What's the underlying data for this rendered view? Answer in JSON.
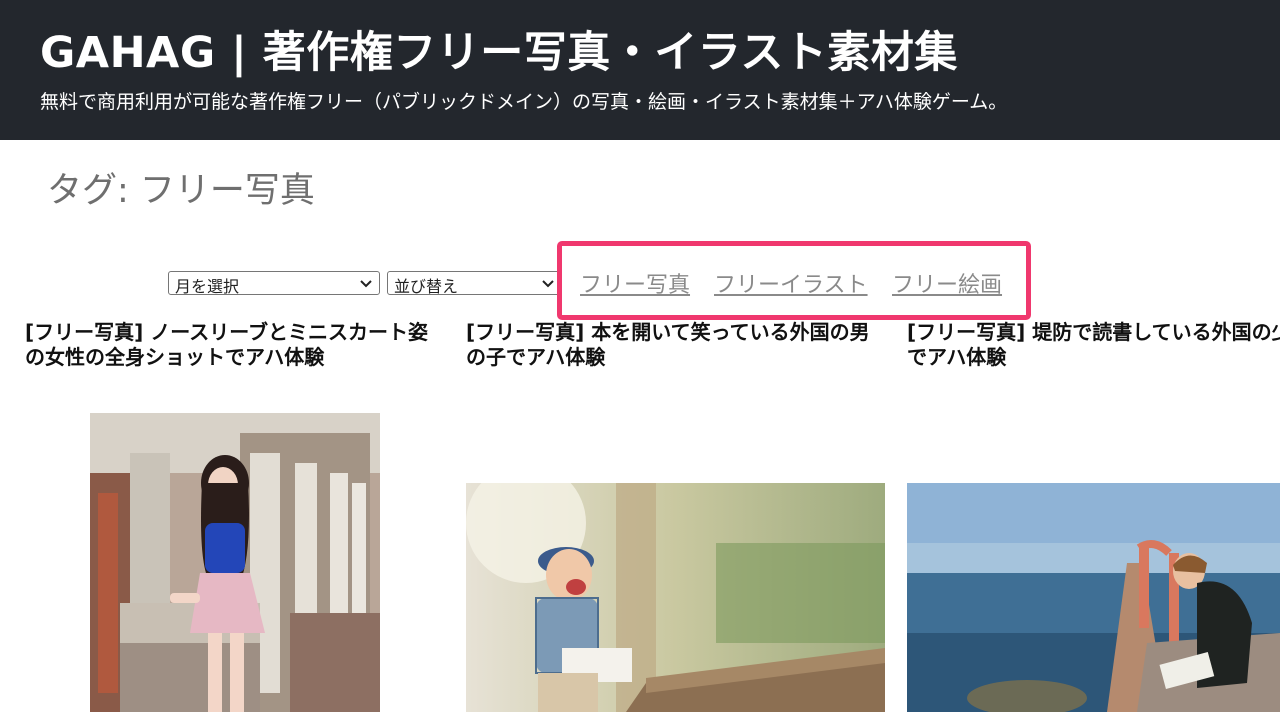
{
  "header": {
    "site_title": "GAHAG | 著作権フリー写真・イラスト素材集",
    "site_description": "無料で商用利用が可能な著作権フリー（パブリックドメイン）の写真・絵画・イラスト素材集＋アハ体験ゲーム。"
  },
  "archive": {
    "title": "タグ: フリー写真"
  },
  "filters": {
    "month_select": "月を選択",
    "sort_select": "並び替え"
  },
  "tag_links": [
    {
      "label": "フリー写真"
    },
    {
      "label": "フリーイラスト"
    },
    {
      "label": "フリー絵画"
    }
  ],
  "posts": [
    {
      "title": "[フリー写真] ノースリーブとミニスカート姿の女性の全身ショットでアハ体験"
    },
    {
      "title": "[フリー写真] 本を開いて笑っている外国の男の子でアハ体験"
    },
    {
      "title": "[フリー写真] 堤防で読書している外国の少年でアハ体験"
    }
  ],
  "colors": {
    "header_bg": "#23272d",
    "highlight_border": "#f0386e",
    "tag_link": "#8a8a8a"
  }
}
